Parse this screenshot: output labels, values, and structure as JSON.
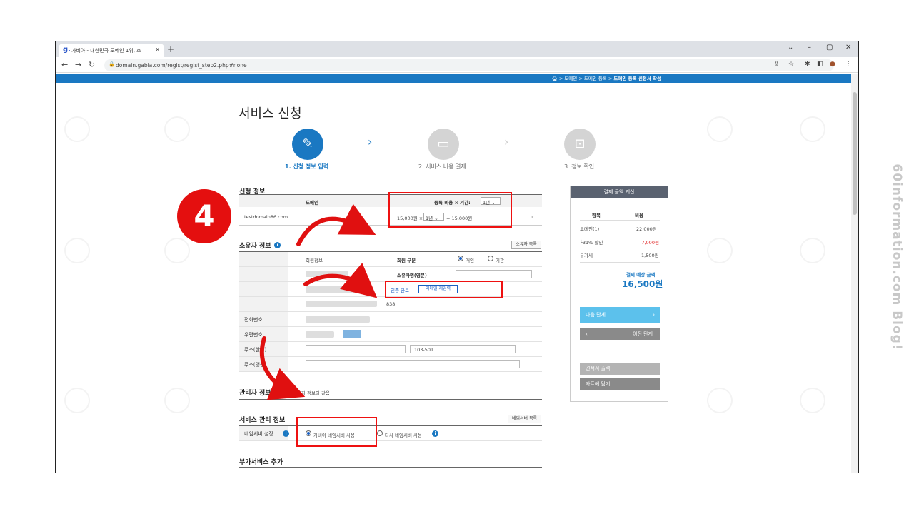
{
  "watermark": "60information.com Blog!",
  "browser": {
    "tab_title": "가비아 - 대한민국 도메인 1위, 호",
    "tab_favicon": "g.",
    "url": "domain.gabia.com/regist/regist_step2.php#none"
  },
  "page": {
    "breadcrumb_home": "> 도메인 > 도메인 등록 >",
    "breadcrumb_current": "도메인 등록 신청서 작성",
    "title": "서비스 신청",
    "steps": [
      {
        "label": "1. 신청 정보 입력",
        "active": true
      },
      {
        "label": "2. 서비스 비용 결제",
        "active": false
      },
      {
        "label": "3. 정보 확인",
        "active": false
      }
    ]
  },
  "application_info": {
    "section_title": "신청 정보",
    "col_domain": "도메인",
    "col_fee": "등록 비용 × 기간:",
    "period_select": "1년",
    "domain_name": "testdomain86.com",
    "price_unit": "15,000원 ×",
    "row_period": "1년",
    "row_total": "= 15,000원",
    "remove_icon": "×"
  },
  "owner_info": {
    "section_title": "소유자 정보",
    "list_button": "소유자 목록",
    "member_info": "회원정보",
    "member_type_label": "회원 구분",
    "type_individual": "개인",
    "type_org": "기관",
    "owner_name_en_label": "소유자명(영문)",
    "verify_done": "인증 완료",
    "email_change_btn": "이메일 재입력",
    "partial_number": "838",
    "phone_label": "전화번호",
    "postal_label": "우편번호",
    "address_kr_label": "주소(한글)",
    "address_detail": "103-501",
    "address_en_label": "주소(영문)"
  },
  "admin_info": {
    "section_title": "관리자 정보",
    "same_as_owner": "소유자 정보와 같음"
  },
  "service_management": {
    "section_title": "서비스 관리 정보",
    "nameserver_list_btn": "네임서버 목록",
    "nameserver_label": "네임서버 설정",
    "opt_gabia": "가비아 네임서버 사용",
    "opt_other": "타사 네임서버 사용"
  },
  "addon": {
    "section_title": "부가서비스 추가"
  },
  "payment_sidebar": {
    "title": "결제 금액 계산",
    "col_item": "항목",
    "col_cost": "비용",
    "rows": [
      {
        "item": "도메인(1)",
        "cost": "22,000원"
      },
      {
        "item": "└31% 할인",
        "cost": "-7,000원"
      },
      {
        "item": "부가세",
        "cost": "1,500원"
      }
    ],
    "estimate_label": "결제 예상 금액",
    "estimate_value": "16,500원",
    "next_btn": "다음 단계",
    "prev_btn": "이전 단계",
    "quote_btn": "견적서 출력",
    "cart_btn": "카트에 담기"
  },
  "overlay": {
    "step_number": "4"
  },
  "colors": {
    "accent": "#1a78c2",
    "annotation_red": "#e11111",
    "discount_red": "#e02020"
  }
}
